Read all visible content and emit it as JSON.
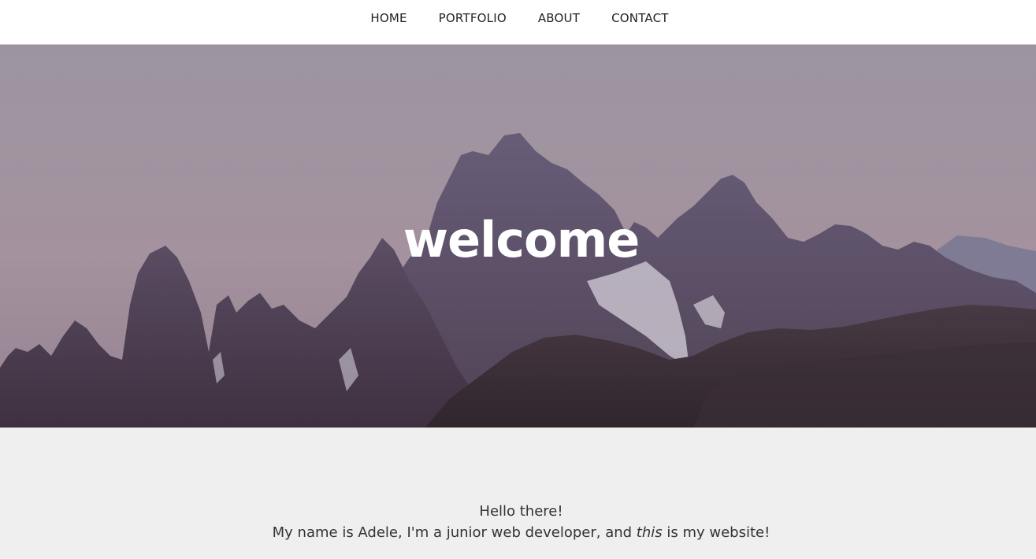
{
  "nav": {
    "items": [
      {
        "label": "HOME"
      },
      {
        "label": "PORTFOLIO"
      },
      {
        "label": "ABOUT"
      },
      {
        "label": "CONTACT"
      }
    ]
  },
  "hero": {
    "title": "welcome",
    "background": "mountain-range-photo",
    "colors": {
      "sky_top": "#a9a2ad",
      "sky_bottom": "#b49fa9",
      "rock_far": "#6b5e78",
      "rock_near": "#4a3c4a",
      "foreground": "#3a2e35"
    }
  },
  "intro": {
    "greeting": "Hello there!",
    "desc_before": "My name is Adele, I'm a junior web developer, and ",
    "desc_emphasis": "this",
    "desc_after": " is my website!"
  }
}
